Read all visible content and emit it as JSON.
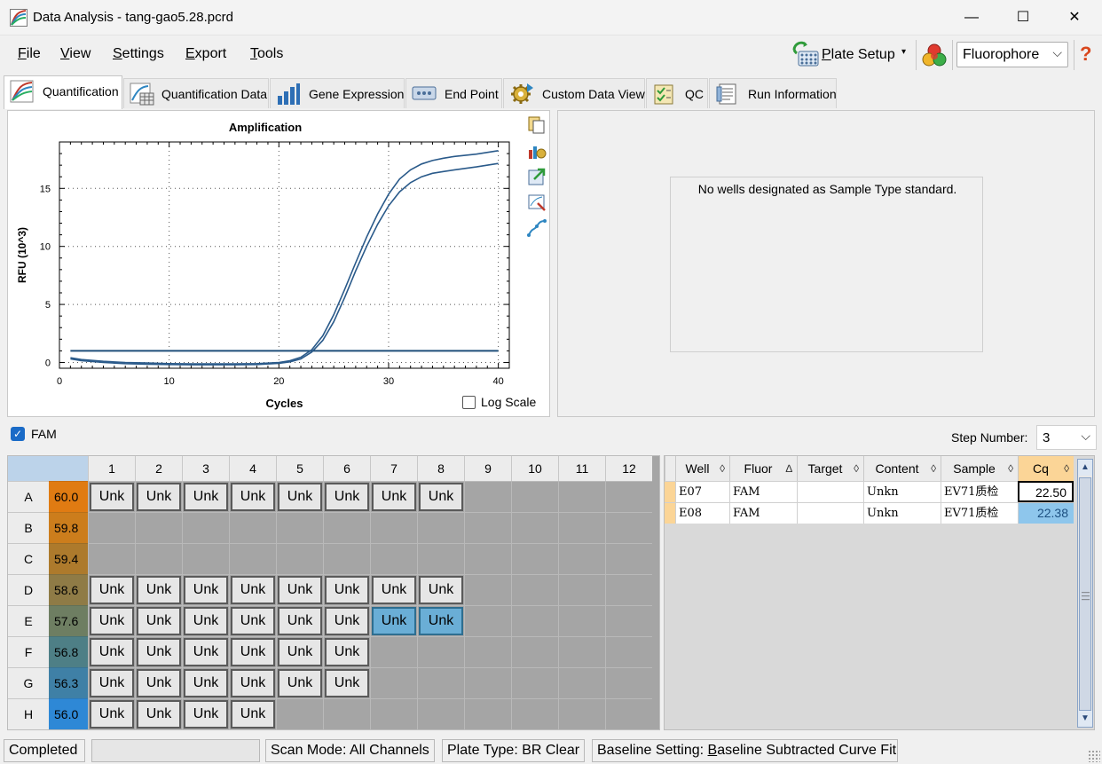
{
  "window": {
    "title": "Data Analysis - tang-gao5.28.pcrd",
    "minimize": "—",
    "maximize": "☐",
    "close": "✕"
  },
  "menu": {
    "items": [
      {
        "label": "File",
        "accel": "F",
        "rest": "ile"
      },
      {
        "label": "View",
        "accel": "V",
        "rest": "iew"
      },
      {
        "label": "Settings",
        "accel": "S",
        "rest": "ettings"
      },
      {
        "label": "Export",
        "accel": "E",
        "rest": "xport"
      },
      {
        "label": "Tools",
        "accel": "T",
        "rest": "ools"
      }
    ],
    "plate_setup": {
      "accel": "P",
      "rest": "late Setup",
      "caret": "▾"
    },
    "fluorophore": {
      "value": "Fluorophore",
      "caret": "⌵"
    },
    "help": "?"
  },
  "tabs": [
    {
      "label": "Quantification",
      "icon": "amplification-icon",
      "active": true
    },
    {
      "label": "Quantification Data",
      "icon": "data-sheet-icon"
    },
    {
      "label": "Gene Expression",
      "icon": "bar-chart-icon"
    },
    {
      "label": "End Point",
      "icon": "end-point-icon"
    },
    {
      "label": "Custom Data View",
      "icon": "gear-icon"
    },
    {
      "label": "QC",
      "icon": "checklist-icon"
    },
    {
      "label": "Run Information",
      "icon": "notepad-icon"
    }
  ],
  "chart": {
    "log_scale": "Log Scale",
    "log_scale_checked": false
  },
  "chart_data": {
    "type": "line",
    "title": "Amplification",
    "xlabel": "Cycles",
    "ylabel": "RFU (10^3)",
    "xlim": [
      0,
      41
    ],
    "ylim": [
      -0.5,
      19
    ],
    "xticks": [
      0,
      10,
      20,
      30,
      40
    ],
    "yticks": [
      0,
      5,
      10,
      15
    ],
    "grid": "dotted",
    "threshold": 1.0,
    "series": [
      {
        "color": "#2a5a8a",
        "x": [
          1,
          2,
          4,
          6,
          8,
          10,
          12,
          14,
          16,
          18,
          20,
          21,
          22,
          23,
          24,
          25,
          26,
          27,
          28,
          29,
          30,
          31,
          32,
          33,
          34,
          35,
          36,
          38,
          40
        ],
        "y": [
          0.4,
          0.25,
          0.1,
          0.0,
          -0.05,
          -0.1,
          -0.12,
          -0.12,
          -0.12,
          -0.1,
          0.0,
          0.15,
          0.45,
          1.1,
          2.3,
          4.1,
          6.3,
          8.6,
          10.8,
          12.8,
          14.5,
          15.8,
          16.6,
          17.1,
          17.4,
          17.6,
          17.75,
          17.95,
          18.25
        ]
      },
      {
        "color": "#2a5a8a",
        "x": [
          1,
          2,
          4,
          6,
          8,
          10,
          12,
          14,
          16,
          18,
          20,
          21,
          22,
          23,
          24,
          25,
          26,
          27,
          28,
          29,
          30,
          31,
          32,
          33,
          34,
          35,
          36,
          38,
          40
        ],
        "y": [
          0.3,
          0.15,
          0.0,
          -0.1,
          -0.15,
          -0.18,
          -0.2,
          -0.2,
          -0.2,
          -0.18,
          -0.08,
          0.05,
          0.3,
          0.9,
          1.9,
          3.5,
          5.6,
          7.9,
          10.0,
          11.9,
          13.5,
          14.7,
          15.5,
          16.0,
          16.3,
          16.45,
          16.6,
          16.85,
          17.15
        ]
      }
    ]
  },
  "standard_curve": {
    "message": "No wells designated as Sample Type standard."
  },
  "fluor_filter": {
    "label": "FAM",
    "checked": true
  },
  "step": {
    "label": "Step Number:",
    "value": "3",
    "caret": "⌵"
  },
  "plate": {
    "columns": [
      "1",
      "2",
      "3",
      "4",
      "5",
      "6",
      "7",
      "8",
      "9",
      "10",
      "11",
      "12"
    ],
    "rows": [
      {
        "label": "A",
        "temp": "60.0",
        "color": "#e07b12",
        "wells": [
          "Unk",
          "Unk",
          "Unk",
          "Unk",
          "Unk",
          "Unk",
          "Unk",
          "Unk"
        ]
      },
      {
        "label": "B",
        "temp": "59.8",
        "color": "#cc7d1c",
        "wells": []
      },
      {
        "label": "C",
        "temp": "59.4",
        "color": "#ad7a2c",
        "wells": []
      },
      {
        "label": "D",
        "temp": "58.6",
        "color": "#8f7b46",
        "wells": [
          "Unk",
          "Unk",
          "Unk",
          "Unk",
          "Unk",
          "Unk",
          "Unk",
          "Unk"
        ]
      },
      {
        "label": "E",
        "temp": "57.6",
        "color": "#6e7e62",
        "wells": [
          "Unk",
          "Unk",
          "Unk",
          "Unk",
          "Unk",
          "Unk",
          "Unk",
          "Unk"
        ],
        "selected": [
          6,
          7
        ]
      },
      {
        "label": "F",
        "temp": "56.8",
        "color": "#4e7f86",
        "wells": [
          "Unk",
          "Unk",
          "Unk",
          "Unk",
          "Unk",
          "Unk"
        ]
      },
      {
        "label": "G",
        "temp": "56.3",
        "color": "#3f80a6",
        "wells": [
          "Unk",
          "Unk",
          "Unk",
          "Unk",
          "Unk",
          "Unk"
        ]
      },
      {
        "label": "H",
        "temp": "56.0",
        "color": "#2e88d6",
        "wells": [
          "Unk",
          "Unk",
          "Unk",
          "Unk"
        ]
      }
    ]
  },
  "results": {
    "headers": [
      {
        "label": "Well",
        "sort": "◊"
      },
      {
        "label": "Fluor",
        "sort": "∆"
      },
      {
        "label": "Target",
        "sort": "◊"
      },
      {
        "label": "Content",
        "sort": "◊"
      },
      {
        "label": "Sample",
        "sort": "◊"
      },
      {
        "label": "Cq",
        "sort": "◊"
      }
    ],
    "rows": [
      [
        "E07",
        "FAM",
        "",
        "Unkn",
        "EV71质检",
        "22.50"
      ],
      [
        "E08",
        "FAM",
        "",
        "Unkn",
        "EV71质检",
        "22.38"
      ]
    ]
  },
  "status": {
    "state": "Completed",
    "scan_mode": "Scan Mode: All Channels",
    "plate_type": "Plate Type: BR Clear",
    "baseline_prefix": "Baseline Setting: ",
    "baseline_accel": "B",
    "baseline_rest": "aseline Subtracted Curve Fit"
  }
}
